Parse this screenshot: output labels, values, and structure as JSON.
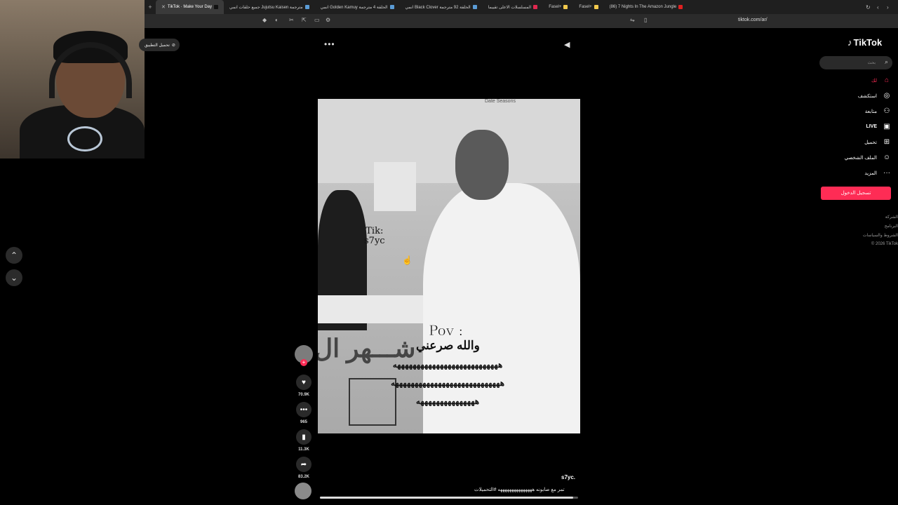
{
  "browser": {
    "tabs": [
      {
        "label": "TikTok · Make Your Day",
        "active": true,
        "fav": "#111111"
      },
      {
        "label": "جميع حلقات انمي Jujutsu Kaisen مترجمة",
        "active": false,
        "fav": "#5a9bd5"
      },
      {
        "label": "انمي Golden Kamuy الحلقة 4 مترجمة",
        "active": false,
        "fav": "#5a9bd5"
      },
      {
        "label": "انمي Black Clover الحلقة 92 مترجمة",
        "active": false,
        "fav": "#5a9bd5"
      },
      {
        "label": "المسلسلات الاعلى تقييما",
        "active": false,
        "fav": "#e0284f"
      },
      {
        "label": "Fasel+",
        "active": false,
        "fav": "#f2c94c"
      },
      {
        "label": "Fasel+",
        "active": false,
        "fav": "#f2c94c"
      },
      {
        "label": "(86) 7 Nights In The Amazon Jungle",
        "active": false,
        "fav": "#e02020"
      }
    ],
    "url": "tiktok.com/ar/"
  },
  "overlay": {
    "badge_label": "تحميل التطبيق"
  },
  "video": {
    "tik_watermark": "Tik:\ns7yc",
    "pov": "Pov :",
    "caption_line1": "والله صرعني",
    "caption_line2": "هههههههههههههههههههههههههههه",
    "caption_line3": "ههههههههههههههههههههههههههههه",
    "caption_line4": "هههههههههههههههه",
    "bg_text": "شـــهر ال",
    "sign_text": "Date Seasons",
    "username": "s7yc.",
    "description": "تمر مع صابونه هههههههههههههههه #التحميلات",
    "progress": 0.98
  },
  "actions": {
    "likes": "70.9K",
    "comments": "965",
    "saves": "11.3K",
    "shares": "83.2K"
  },
  "sidebar": {
    "brand": "TikTok",
    "search_placeholder": "بحث",
    "nav": [
      {
        "label": "لك",
        "icon": "home-icon",
        "glyph": "⌂",
        "active": true
      },
      {
        "label": "استكشف",
        "icon": "compass-icon",
        "glyph": "◎",
        "active": false
      },
      {
        "label": "متابعة",
        "icon": "following-icon",
        "glyph": "⚇",
        "active": false
      },
      {
        "label": "LIVE",
        "icon": "live-icon",
        "glyph": "▣",
        "active": false
      },
      {
        "label": "تحميل",
        "icon": "upload-icon",
        "glyph": "⊞",
        "active": false
      },
      {
        "label": "الملف الشخصي",
        "icon": "profile-icon",
        "glyph": "☺",
        "active": false
      },
      {
        "label": "المزيد",
        "icon": "more-icon",
        "glyph": "···",
        "active": false
      }
    ],
    "login_label": "تسجيل الدخول",
    "footer": [
      "الشركة",
      "البرنامج",
      "الشروط والسياسات",
      "© 2026 TikTok"
    ]
  }
}
